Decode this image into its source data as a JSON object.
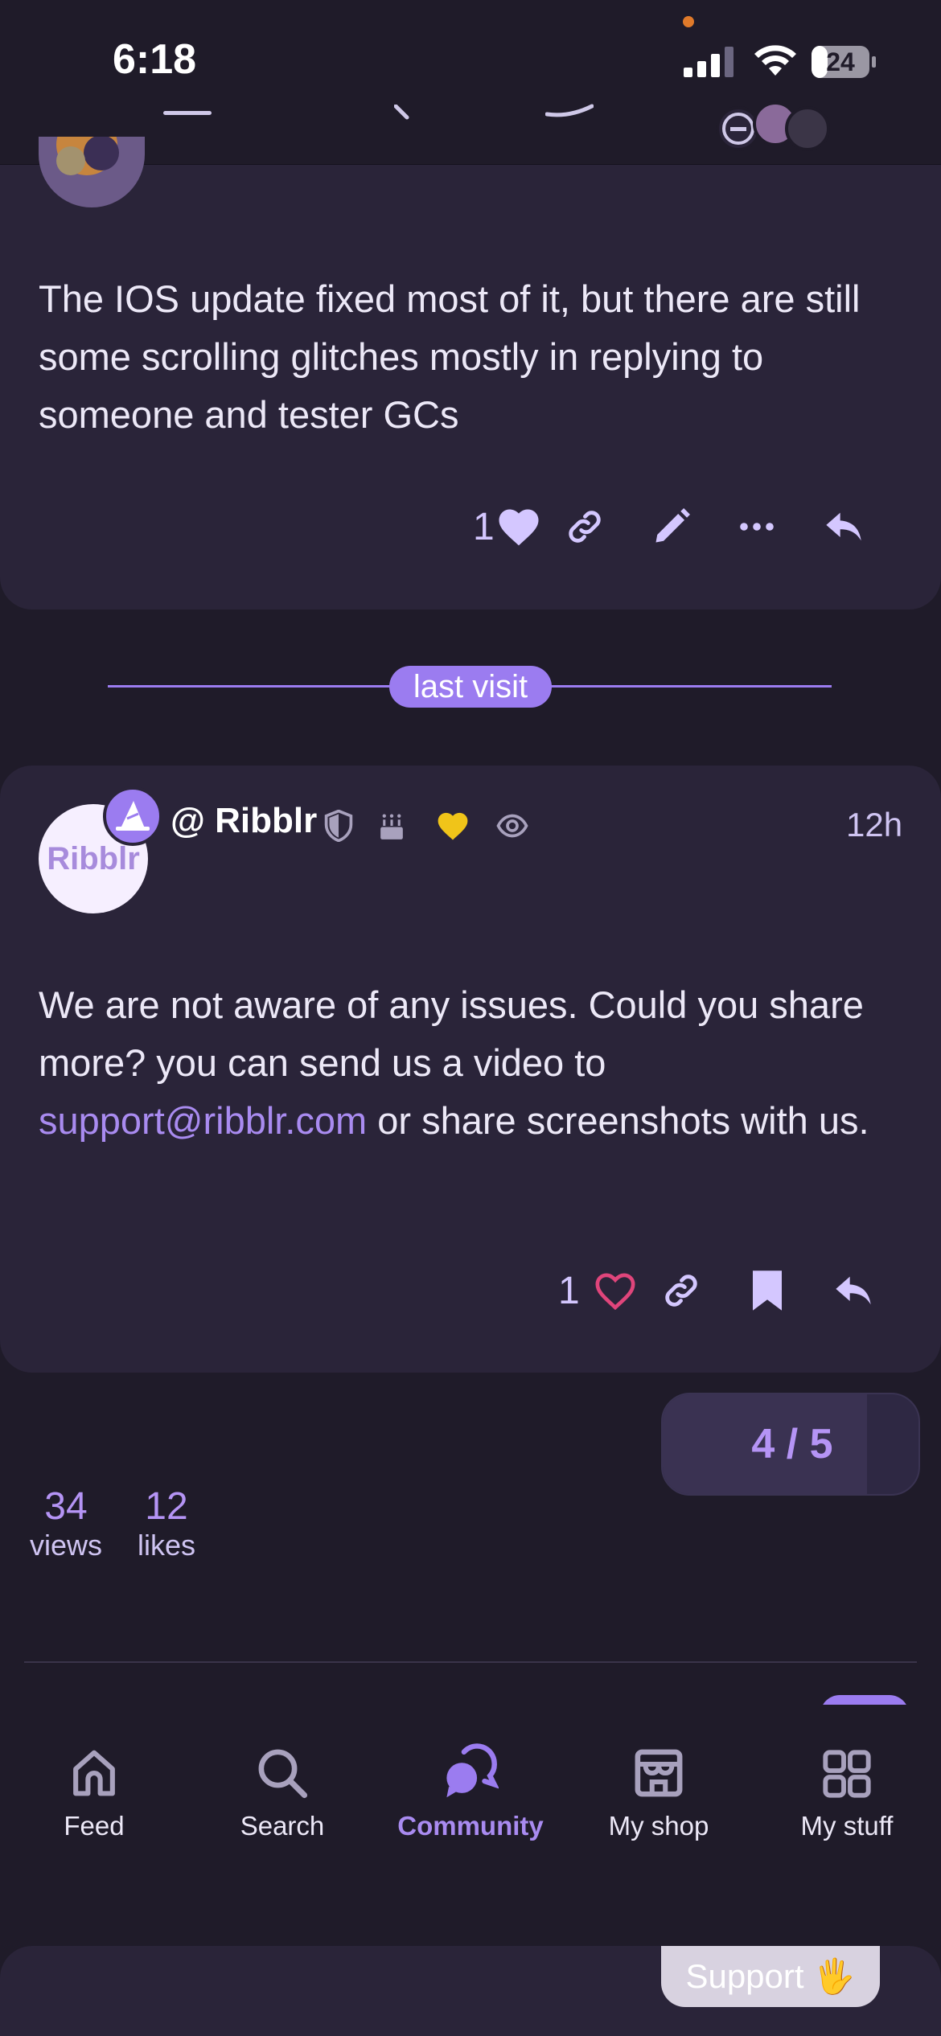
{
  "status_bar": {
    "time": "6:18",
    "battery": "24"
  },
  "post_1": {
    "text": "The IOS update fixed most of it, but there are still some scrolling glitches mostly in replying to someone and tester GCs",
    "like_count": "1"
  },
  "divider": {
    "label": "last visit"
  },
  "post_2": {
    "author": "@ Ribblr",
    "avatar_text": "Ribblr",
    "timestamp": "12h",
    "text_before": "We are not aware of any issues. Could you share more? you can send us a video to ",
    "link": "support@ribblr.com",
    "text_after": " or share screenshots with us.",
    "like_count": "1"
  },
  "progress": {
    "label": "4 / 5",
    "current": 4,
    "total": 5
  },
  "stats": {
    "views_count": "34",
    "views_label": "views",
    "likes_count": "12",
    "likes_label": "likes"
  },
  "tabs": [
    {
      "label": "Feed",
      "icon": "home-icon"
    },
    {
      "label": "Search",
      "icon": "search-icon"
    },
    {
      "label": "Community",
      "icon": "chat-bubbles-icon",
      "active": true
    },
    {
      "label": "My shop",
      "icon": "shop-icon"
    },
    {
      "label": "My stuff",
      "icon": "grid-icon"
    }
  ],
  "support": {
    "label": "Support 🖐"
  },
  "colors": {
    "background": "#1f1b29",
    "card": "#2a2439",
    "accent": "#9b7cf0",
    "heart_pink": "#e0457b",
    "gold": "#f0c419"
  }
}
